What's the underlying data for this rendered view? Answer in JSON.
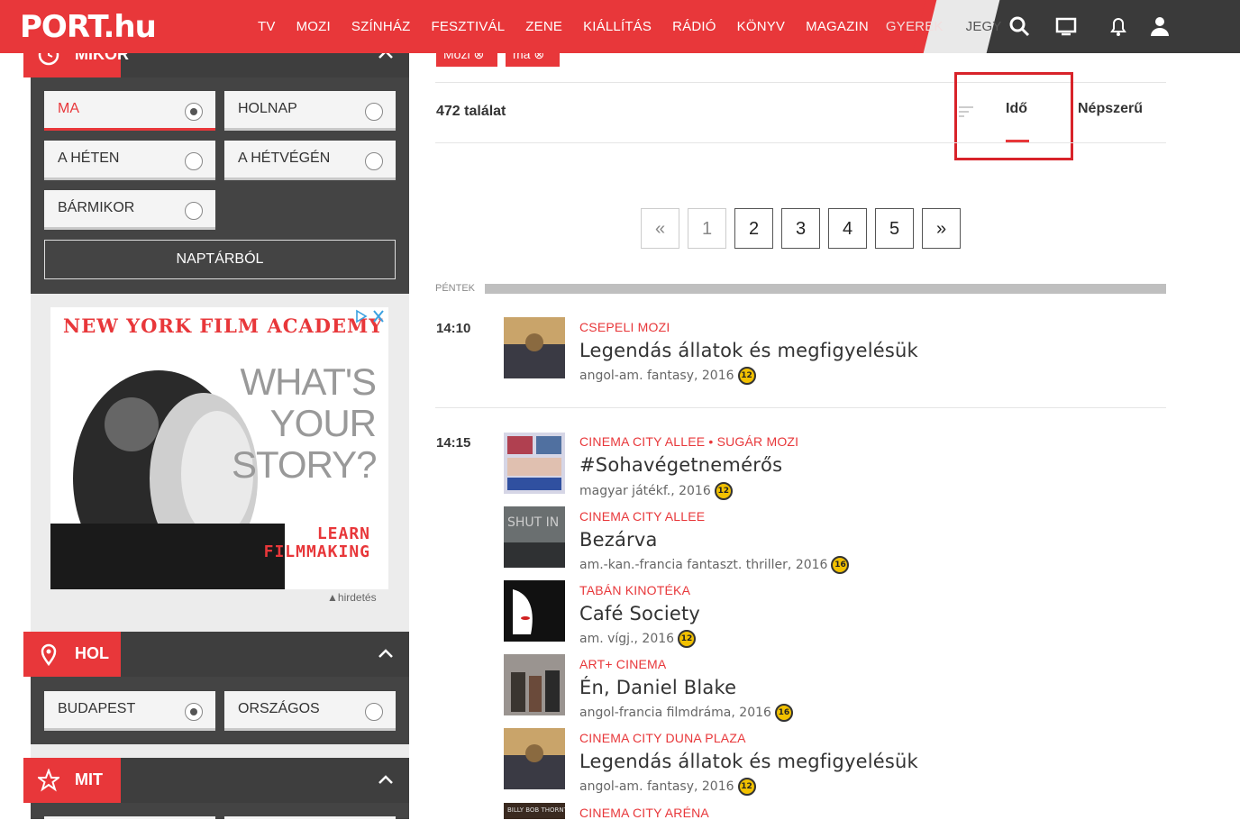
{
  "header": {
    "logo": "PORT.hu",
    "nav": [
      "TV",
      "MOZI",
      "SZÍNHÁZ",
      "FESZTIVÁL",
      "ZENE",
      "KIÁLLÍTÁS",
      "RÁDIÓ",
      "KÖNYV",
      "MAGAZIN",
      "GYEREK",
      "JEGY"
    ],
    "icons": [
      "search-icon",
      "tv-icon",
      "bell-icon",
      "user-icon"
    ],
    "accent": "#e8373a"
  },
  "sidebar": {
    "mikor": {
      "title": "MIKOR",
      "options": [
        "MA",
        "HOLNAP",
        "A HÉTEN",
        "A HÉTVÉGÉN",
        "BÁRMIKOR"
      ],
      "selected": "MA",
      "calendar_button": "NAPTÁRBÓL"
    },
    "ad": {
      "headline": "NEW YORK FILM ACADEMY",
      "question": "WHAT'S YOUR STORY?",
      "cta": "LEARN FILMMAKING",
      "label": "hirdetés"
    },
    "hol": {
      "title": "HOL",
      "options": [
        "BUDAPEST",
        "ORSZÁGOS"
      ],
      "selected": "BUDAPEST"
    },
    "mit": {
      "title": "MIT"
    }
  },
  "filters": {
    "chips": [
      "Mozi",
      "ma"
    ]
  },
  "results": {
    "count": "472 találat",
    "sort": {
      "active": "Idő",
      "other": "Népszerű"
    }
  },
  "pagination": {
    "prev": "«",
    "pages": [
      "1",
      "2",
      "3",
      "4",
      "5"
    ],
    "next": "»",
    "current": "1"
  },
  "day_label": "PÉNTEK",
  "listings": [
    {
      "time": "14:10",
      "venue": "CSEPELI MOZI",
      "title": "Legendás állatok és megfigyelésük",
      "meta": "angol-am. fantasy, 2016",
      "age": "12"
    },
    {
      "time": "14:15",
      "venue": "CINEMA CITY ALLEE • SUGÁR MOZI",
      "title": "#Sohavégetnemérős",
      "meta": "magyar játékf., 2016",
      "age": "12"
    },
    {
      "time": "",
      "venue": "CINEMA CITY ALLEE",
      "title": "Bezárva",
      "meta": "am.-kan.-francia fantaszt. thriller, 2016",
      "age": "16"
    },
    {
      "time": "",
      "venue": "TABÁN KINOTÉKA",
      "title": "Café Society",
      "meta": "am. vígj., 2016",
      "age": "12"
    },
    {
      "time": "",
      "venue": "ART+ CINEMA",
      "title": "Én, Daniel Blake",
      "meta": "angol-francia filmdráma, 2016",
      "age": "16"
    },
    {
      "time": "",
      "venue": "CINEMA CITY DUNA PLAZA",
      "title": "Legendás állatok és megfigyelésük",
      "meta": "angol-am. fantasy, 2016",
      "age": "12"
    },
    {
      "time": "",
      "venue": "CINEMA CITY ARÉNA",
      "title": "",
      "meta": "",
      "age": ""
    }
  ]
}
